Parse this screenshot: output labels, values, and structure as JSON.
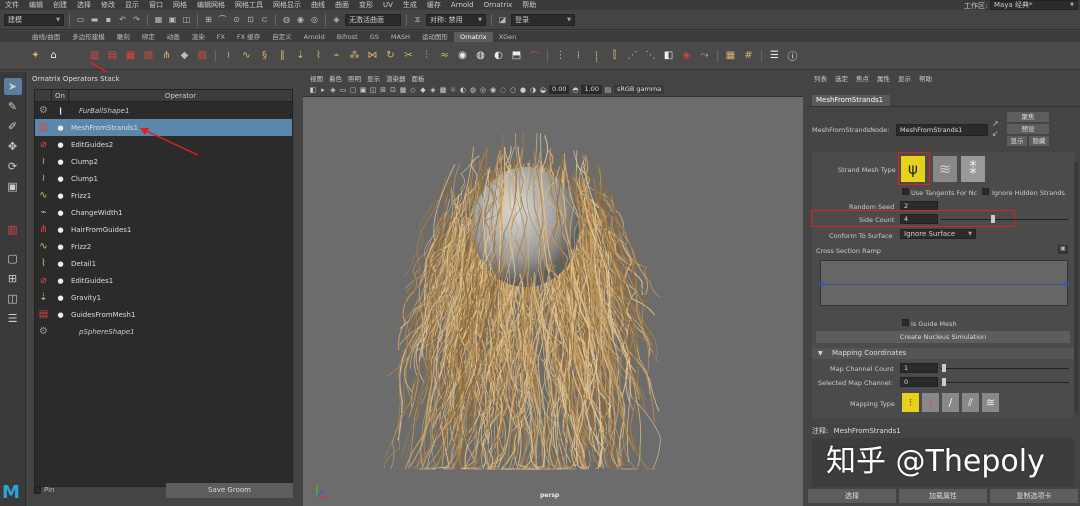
{
  "menubar": {
    "items": [
      "文件",
      "编辑",
      "创建",
      "选择",
      "修改",
      "显示",
      "窗口",
      "网格",
      "编辑网格",
      "网格工具",
      "网格显示",
      "曲线",
      "曲面",
      "变形",
      "UV",
      "生成",
      "缓存",
      "Arnold",
      "Ornatrix",
      "帮助"
    ],
    "workspace_label": "工作区:",
    "workspace_value": "Maya 经典*"
  },
  "statusline": {
    "mode": "建模",
    "surface": "无激活曲面",
    "symmetry": "对称: 禁用",
    "login": "登录"
  },
  "shelf": {
    "tabs": [
      "曲线/曲面",
      "多边形建模",
      "雕刻",
      "绑定",
      "动画",
      "渲染",
      "FX",
      "FX 缓存",
      "自定义",
      "Arnold",
      "Bifrost",
      "GS",
      "MASH",
      "运动图形",
      "Ornatrix",
      "XGen"
    ],
    "active_tab": "Ornatrix"
  },
  "operators_panel": {
    "title": "Ornatrix Operators Stack",
    "col_on": "On",
    "col_operator": "Operator",
    "rows": [
      {
        "name": "FurBallShape1",
        "italic": true,
        "selected": false,
        "icon": "gear-icon"
      },
      {
        "name": "MeshFromStrands1",
        "italic": false,
        "selected": true,
        "icon": "mesh-from-strands-icon"
      },
      {
        "name": "EditGuides2",
        "italic": false,
        "selected": false,
        "icon": "edit-guides-icon"
      },
      {
        "name": "Clump2",
        "italic": false,
        "selected": false,
        "icon": "clump-icon"
      },
      {
        "name": "Clump1",
        "italic": false,
        "selected": false,
        "icon": "clump-icon"
      },
      {
        "name": "Frizz1",
        "italic": false,
        "selected": false,
        "icon": "frizz-icon"
      },
      {
        "name": "ChangeWidth1",
        "italic": false,
        "selected": false,
        "icon": "change-width-icon"
      },
      {
        "name": "HairFromGuides1",
        "italic": false,
        "selected": false,
        "icon": "hair-from-guides-icon"
      },
      {
        "name": "Frizz2",
        "italic": false,
        "selected": false,
        "icon": "frizz-icon"
      },
      {
        "name": "Detail1",
        "italic": false,
        "selected": false,
        "icon": "detail-icon"
      },
      {
        "name": "EditGuides1",
        "italic": false,
        "selected": false,
        "icon": "edit-guides-icon"
      },
      {
        "name": "Gravity1",
        "italic": false,
        "selected": false,
        "icon": "gravity-icon"
      },
      {
        "name": "GuidesFromMesh1",
        "italic": false,
        "selected": false,
        "icon": "guides-from-mesh-icon"
      },
      {
        "name": "pSphereShape1",
        "italic": true,
        "selected": false,
        "icon": "gear-icon"
      }
    ],
    "pin_label": "Pin",
    "save_label": "Save Groom"
  },
  "viewport": {
    "menu": [
      "视图",
      "着色",
      "照明",
      "显示",
      "渲染器",
      "面板"
    ],
    "num_a": "0.00",
    "num_b": "1.00",
    "color_space": "sRGB gamma",
    "camera": "persp"
  },
  "attribute_editor": {
    "menu": [
      "列表",
      "选定",
      "焦点",
      "属性",
      "显示",
      "帮助"
    ],
    "tab": "MeshFromStrands1",
    "node_label": "MeshFromStrandsNode:",
    "node_value": "MeshFromStrands1",
    "focus_btn": "聚焦",
    "preset_btn": "预设",
    "show_btn": "显示",
    "hide_btn": "隐藏",
    "strand_mesh_type_label": "Strand Mesh Type",
    "use_tangents_label": "Use Tangents For Nc",
    "ignore_hidden_label": "Ignore Hidden Strands",
    "random_seed_label": "Random Seed",
    "random_seed_value": "2",
    "side_count_label": "Side Count",
    "side_count_value": "4",
    "side_count_fraction": 0.25,
    "conform_label": "Conform To Surface",
    "conform_value": "Ignore Surface",
    "ramp_label": "Cross Section Ramp",
    "is_guide_mesh_label": "Is Guide Mesh",
    "create_nucleus_label": "Create Nucleus Simulation",
    "mapping_section": "Mapping Coordinates",
    "map_channel_count_label": "Map Channel Count",
    "map_channel_count_value": "1",
    "selected_map_channel_label": "Selected Map Channel:",
    "selected_map_channel_value": "0",
    "mapping_type_label": "Mapping Type",
    "notes_label": "注释:",
    "notes_value": "MeshFromStrands1",
    "bottom_select": "选择",
    "bottom_load": "加载属性",
    "bottom_copy": "复制选项卡"
  },
  "watermark": "知乎 @Thepoly",
  "colors": {
    "accent_blue": "#5b87aa",
    "annotation_red": "#e0201c",
    "hair_gold": "#c9a36a",
    "maya_blue": "#2aa7d8"
  }
}
